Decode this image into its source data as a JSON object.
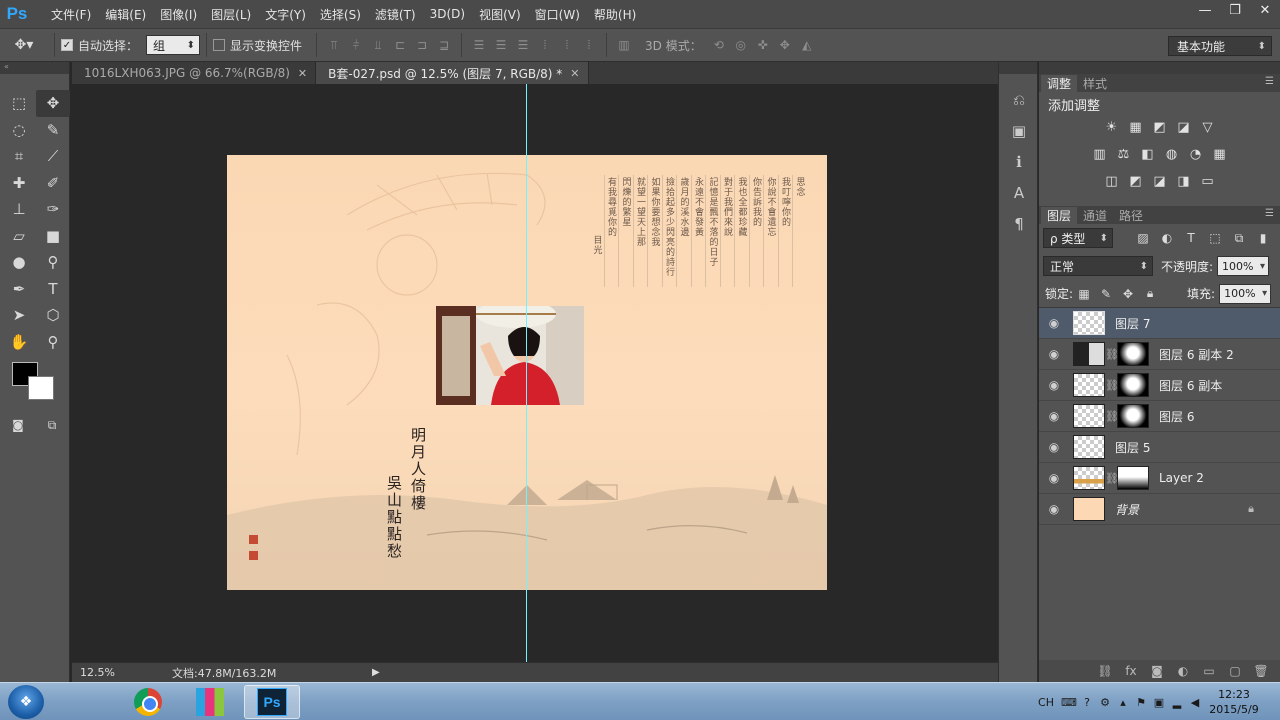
{
  "app": {
    "logo": "Ps"
  },
  "menu": [
    "文件(F)",
    "编辑(E)",
    "图像(I)",
    "图层(L)",
    "文字(Y)",
    "选择(S)",
    "滤镜(T)",
    "3D(D)",
    "视图(V)",
    "窗口(W)",
    "帮助(H)"
  ],
  "window_controls": {
    "minimize": "—",
    "restore": "❐",
    "close": "✕"
  },
  "options": {
    "auto_select_label": "自动选择：",
    "auto_select_value": "组",
    "show_transform_label": "显示变换控件",
    "mode3d_label": "3D 模式：",
    "workspace": "基本功能"
  },
  "tabs": [
    {
      "label": "1016LXH063.JPG @ 66.7%(RGB/8)",
      "close": "✕"
    },
    {
      "label": "B套-027.psd @ 12.5% (图层 7, RGB/8) *",
      "close": "✕"
    }
  ],
  "artwork": {
    "poem_columns": [
      "思念",
      "我叮嚀你的",
      "你說不會遺忘",
      "你告訴我的",
      "我也全都珍藏",
      "對于我們來說",
      "記憶是飄不落的日子",
      "永遠不會發黃",
      "歲月的溪水邊",
      "撿拾起多少閃亮的詩行",
      "如果你要想念我",
      "就望一望天上那",
      "閃爍的繁星",
      "有我尋覓你的"
    ],
    "poem_sign": "目光",
    "calligraphy": [
      "明月人倚樓",
      "吳山點點愁"
    ]
  },
  "status": {
    "zoom": "12.5%",
    "doc": "文档:47.8M/163.2M"
  },
  "adjust_panel": {
    "tabs": [
      "调整",
      "样式"
    ],
    "title": "添加调整",
    "rows": [
      [
        "☀",
        "▦",
        "◩",
        "◪",
        "▽"
      ],
      [
        "▥",
        "⚖",
        "◧",
        "◍",
        "◔",
        "▦"
      ],
      [
        "◫",
        "◩",
        "◪",
        "◨",
        "▭"
      ]
    ]
  },
  "layers_panel": {
    "tabs": [
      "图层",
      "通道",
      "路径"
    ],
    "filter": "ρ 类型",
    "blend": "正常",
    "opacity_label": "不透明度:",
    "opacity": "100%",
    "lock_label": "锁定:",
    "fill_label": "填充:",
    "fill": "100%",
    "layers": [
      {
        "name": "图层 7",
        "selected": true,
        "mask": false
      },
      {
        "name": "图层 6 副本 2",
        "selected": false,
        "mask": true
      },
      {
        "name": "图层 6 副本",
        "selected": false,
        "mask": true
      },
      {
        "name": "图层 6",
        "selected": false,
        "mask": true
      },
      {
        "name": "图层 5",
        "selected": false,
        "mask": false
      },
      {
        "name": "Layer 2",
        "selected": false,
        "mask": true
      },
      {
        "name": "背景",
        "selected": false,
        "mask": false,
        "locked": true
      }
    ]
  },
  "taskbar": {
    "input_method": "CH",
    "time": "12:23",
    "date": "2015/5/9"
  },
  "colors": {
    "accent": "#31a8ff",
    "selected_layer": "#4f5a6a",
    "guide": "#6ff3ff"
  }
}
